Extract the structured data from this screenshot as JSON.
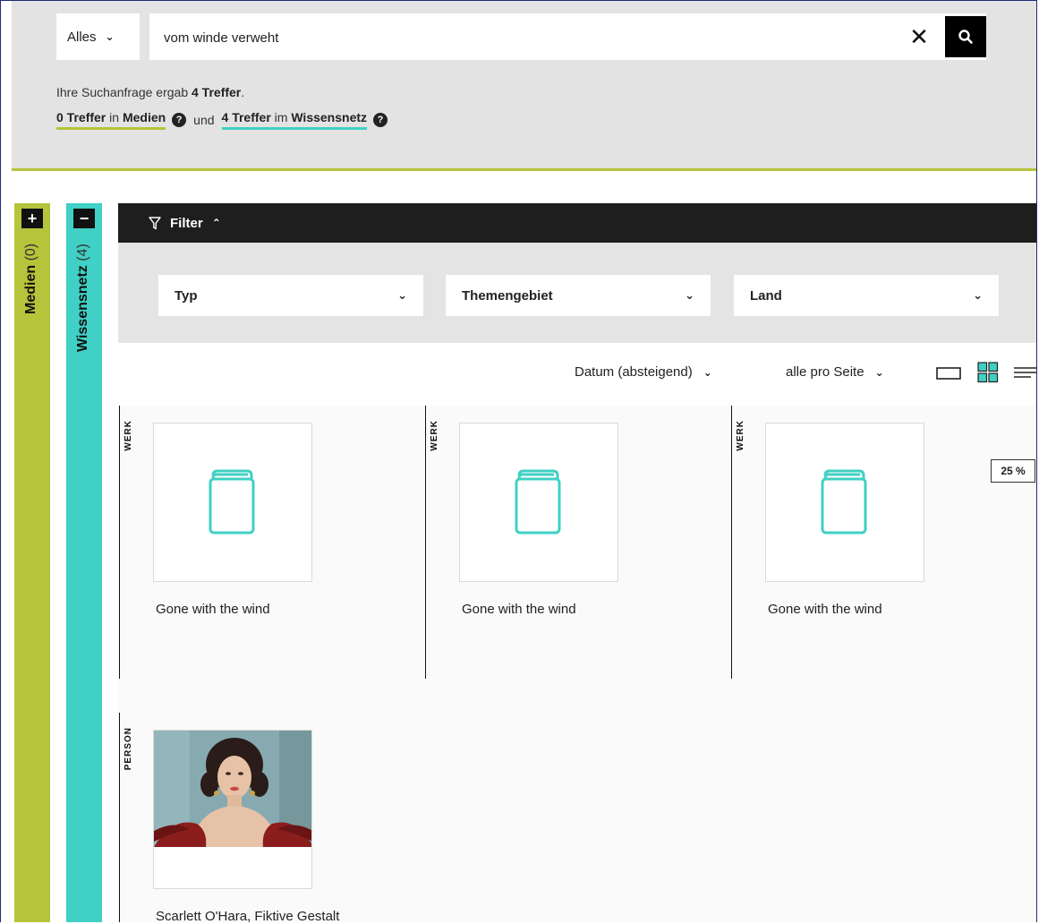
{
  "search": {
    "scope": "Alles",
    "query": "vom winde verweht"
  },
  "summary": {
    "prefix": "Ihre Suchanfrage ergab ",
    "total": "4 Treffer",
    "suffix": "."
  },
  "hits": {
    "media_count": "0 Treffer",
    "media_in": " in ",
    "media_label": "Medien",
    "and": "und",
    "knowledge_count": "4 Treffer",
    "knowledge_in": " im ",
    "knowledge_label": "Wissensnetz"
  },
  "sidebar": {
    "medien": {
      "button": "+",
      "label": "Medien",
      "count": "(0)"
    },
    "wissen": {
      "button": "−",
      "label": "Wissensnetz",
      "count": "(4)"
    }
  },
  "filter": {
    "label": "Filter",
    "dropdowns": [
      "Typ",
      "Themengebiet",
      "Land"
    ]
  },
  "sort": {
    "order": "Datum (absteigend)",
    "per_page": "alle pro Seite"
  },
  "zoom": "25 %",
  "results": [
    {
      "type": "WERK",
      "title": "Gone with the wind",
      "icon": "book-icon"
    },
    {
      "type": "WERK",
      "title": "Gone with the wind",
      "icon": "book-icon"
    },
    {
      "type": "WERK",
      "title": "Gone with the wind",
      "icon": "book-icon"
    },
    {
      "type": "PERSON",
      "title": "Scarlett O'Hara, Fiktive Gestalt",
      "icon": "portrait-image"
    }
  ],
  "colors": {
    "medien": "#b5c43a",
    "wissen": "#40d0c5",
    "dark": "#1e1e1e",
    "panel": "#e3e3e3"
  }
}
